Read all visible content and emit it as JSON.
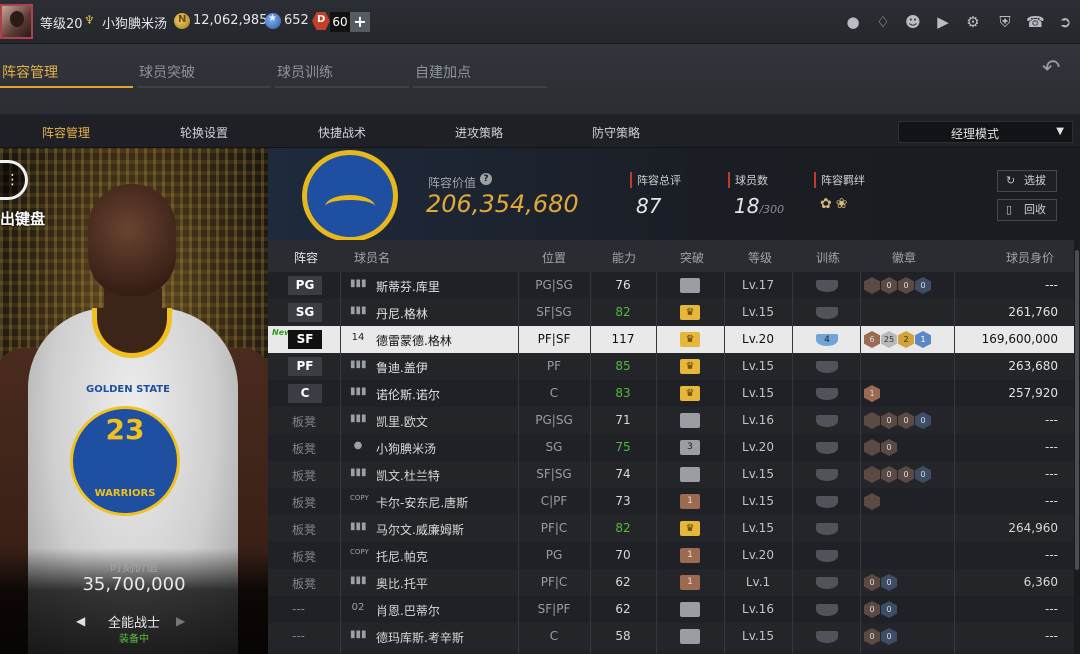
{
  "topbar": {
    "level": "等级20",
    "vip_icon": "vip-badge-icon",
    "nickname": "小狗腆米汤",
    "gold": "12,062,985",
    "points": "652",
    "tokens": "60",
    "plus": "+",
    "icons": [
      "user-icon",
      "bell-icon",
      "friends-icon",
      "video-icon",
      "gear-icon",
      "shield-icon",
      "headset-icon",
      "exit-icon"
    ]
  },
  "main_tabs": [
    {
      "label": "阵容管理",
      "active": true
    },
    {
      "label": "球员突破",
      "active": false
    },
    {
      "label": "球员训练",
      "active": false
    },
    {
      "label": "自建加点",
      "active": false
    }
  ],
  "sub_tabs": [
    {
      "label": "阵容管理",
      "active": true
    },
    {
      "label": "轮换设置",
      "active": false
    },
    {
      "label": "快捷战术",
      "active": false
    },
    {
      "label": "进攻策略",
      "active": false
    },
    {
      "label": "防守策略",
      "active": false
    }
  ],
  "mode_select": {
    "value": "经理模式"
  },
  "left_panel": {
    "keyboard_label": "出键盘",
    "jersey_team": "GOLDEN STATE",
    "jersey_number": "23",
    "jersey_name": "WARRIORS",
    "value_label": "时刻价值",
    "value": "35,700,000",
    "skill_name": "全能战士",
    "skill_state": "装备中"
  },
  "stats": {
    "lineup_value_label": "阵容价值",
    "lineup_value": "206,354,680",
    "rating_label": "阵容总评",
    "rating": "87",
    "count_label": "球员数",
    "count": "18",
    "count_max": "/300",
    "bond_label": "阵容羁绊",
    "pick_button": "选拔",
    "recycle_button": "回收"
  },
  "table": {
    "headers": [
      "阵容",
      "球员名",
      "位置",
      "能力",
      "突破",
      "等级",
      "训练",
      "徽章",
      "球员身价"
    ],
    "rows": [
      {
        "slot": "PG",
        "bench": false,
        "icon": "bars",
        "name": "斯蒂芬.库里",
        "pos": "PG|SG",
        "ability": "76",
        "green": false,
        "brk": "gray",
        "brk_text": "",
        "level": "Lv.17",
        "trn": "",
        "badges": [
          [
            "dk",
            ""
          ],
          [
            "dk",
            "0"
          ],
          [
            "dk",
            "0"
          ],
          [
            "dbl",
            "0"
          ]
        ],
        "value": "---"
      },
      {
        "slot": "SG",
        "bench": false,
        "icon": "bars",
        "name": "丹尼.格林",
        "pos": "SF|SG",
        "ability": "82",
        "green": true,
        "brk": "crown",
        "brk_text": "",
        "level": "Lv.15",
        "trn": "",
        "badges": [],
        "value": "261,760"
      },
      {
        "slot": "SF",
        "bench": false,
        "selected": true,
        "new_tag": "New",
        "icon": "14",
        "name": "德雷蒙德.格林",
        "pos": "PF|SF",
        "ability": "117",
        "green": false,
        "brk": "crown",
        "brk_text": "",
        "level": "Lv.20",
        "trn": "4",
        "badges": [
          [
            "br",
            "6"
          ],
          [
            "sv",
            "25"
          ],
          [
            "gd",
            "2"
          ],
          [
            "bl",
            "1"
          ]
        ],
        "value": "169,600,000"
      },
      {
        "slot": "PF",
        "bench": false,
        "icon": "bars",
        "name": "鲁迪.盖伊",
        "pos": "PF",
        "ability": "85",
        "green": true,
        "brk": "crown",
        "brk_text": "",
        "level": "Lv.15",
        "trn": "",
        "badges": [],
        "value": "263,680"
      },
      {
        "slot": "C",
        "bench": false,
        "icon": "bars",
        "name": "诺伦斯.诺尔",
        "pos": "C",
        "ability": "83",
        "green": true,
        "brk": "crown",
        "brk_text": "",
        "level": "Lv.15",
        "trn": "",
        "badges": [
          [
            "br",
            "1"
          ]
        ],
        "value": "257,920"
      },
      {
        "slot": "板凳",
        "bench": true,
        "icon": "bars",
        "name": "凯里.欧文",
        "pos": "PG|SG",
        "ability": "71",
        "green": false,
        "brk": "gray",
        "brk_text": "",
        "level": "Lv.16",
        "trn": "",
        "badges": [
          [
            "dk",
            ""
          ],
          [
            "dk",
            "0"
          ],
          [
            "dk",
            "0"
          ],
          [
            "dbl",
            "0"
          ]
        ],
        "value": "---"
      },
      {
        "slot": "板凳",
        "bench": true,
        "icon": "user",
        "name": "小狗腆米汤",
        "pos": "SG",
        "ability": "75",
        "green": true,
        "brk": "gray",
        "brk_text": "3",
        "level": "Lv.20",
        "trn": "",
        "badges": [
          [
            "dk",
            ""
          ],
          [
            "dk",
            "0"
          ]
        ],
        "value": "---"
      },
      {
        "slot": "板凳",
        "bench": true,
        "icon": "bars",
        "name": "凯文.杜兰特",
        "pos": "SF|SG",
        "ability": "74",
        "green": false,
        "brk": "gray",
        "brk_text": "",
        "level": "Lv.15",
        "trn": "",
        "badges": [
          [
            "dk",
            ""
          ],
          [
            "dk",
            "0"
          ],
          [
            "dk",
            "0"
          ],
          [
            "dbl",
            "0"
          ]
        ],
        "value": "---"
      },
      {
        "slot": "板凳",
        "bench": true,
        "icon": "copy",
        "name": "卡尔-安东尼.唐斯",
        "pos": "C|PF",
        "ability": "73",
        "green": false,
        "brk": "copper",
        "brk_text": "1",
        "level": "Lv.15",
        "trn": "",
        "badges": [
          [
            "dk",
            ""
          ]
        ],
        "value": "---"
      },
      {
        "slot": "板凳",
        "bench": true,
        "icon": "bars",
        "name": "马尔文.威廉姆斯",
        "pos": "PF|C",
        "ability": "82",
        "green": true,
        "brk": "crown",
        "brk_text": "",
        "level": "Lv.15",
        "trn": "",
        "badges": [],
        "value": "264,960"
      },
      {
        "slot": "板凳",
        "bench": true,
        "icon": "copy",
        "name": "托尼.帕克",
        "pos": "PG",
        "ability": "70",
        "green": false,
        "brk": "copper",
        "brk_text": "1",
        "level": "Lv.20",
        "trn": "",
        "badges": [],
        "value": "---"
      },
      {
        "slot": "板凳",
        "bench": true,
        "icon": "bars",
        "name": "奥比.托平",
        "pos": "PF|C",
        "ability": "62",
        "green": false,
        "brk": "copper",
        "brk_text": "1",
        "level": "Lv.1",
        "trn": "",
        "badges": [
          [
            "dk",
            "0"
          ],
          [
            "dbl",
            "0"
          ]
        ],
        "value": "6,360"
      },
      {
        "slot": "---",
        "bench": true,
        "icon": "02",
        "name": "肖恩.巴蒂尔",
        "pos": "SF|PF",
        "ability": "62",
        "green": false,
        "brk": "gray",
        "brk_text": "",
        "level": "Lv.16",
        "trn": "",
        "badges": [
          [
            "dk",
            "0"
          ],
          [
            "dbl",
            "0"
          ]
        ],
        "value": "---"
      },
      {
        "slot": "---",
        "bench": true,
        "icon": "bars",
        "name": "德玛库斯.考辛斯",
        "pos": "C",
        "ability": "58",
        "green": false,
        "brk": "gray",
        "brk_text": "",
        "level": "Lv.15",
        "trn": "",
        "badges": [
          [
            "dk",
            "0"
          ],
          [
            "dbl",
            "0"
          ]
        ],
        "value": "---"
      }
    ]
  }
}
